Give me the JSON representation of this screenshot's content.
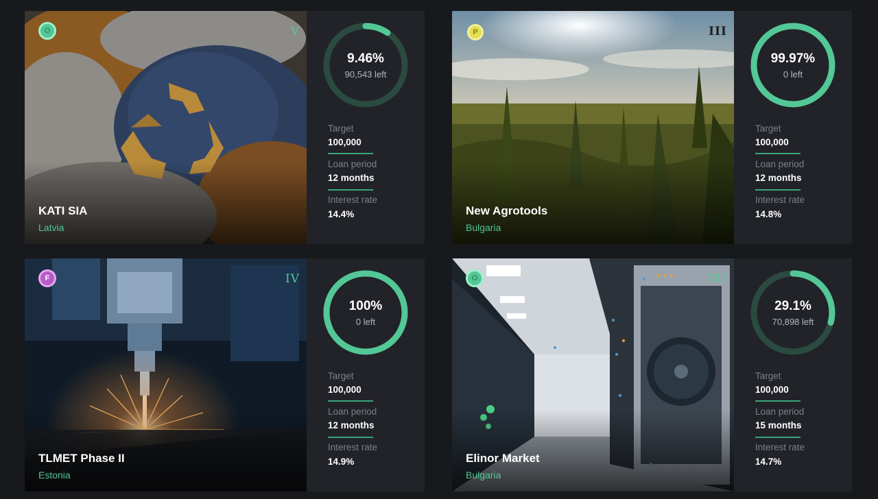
{
  "colors": {
    "background": "#17191d",
    "card": "#212328",
    "accent": "#54c796",
    "ring_track": "#2b4a40",
    "muted_text": "#7b8089"
  },
  "labels": {
    "target": "Target",
    "loan_period": "Loan period",
    "interest_rate": "Interest rate"
  },
  "cards": [
    {
      "name": "KATI SIA",
      "country": "Latvia",
      "badge_letter": "O",
      "roman": "V",
      "progress_label": "9.46%",
      "progress_fraction": 0.0946,
      "left_text": "90,543 left",
      "target": "100,000",
      "loan_period": "12 months",
      "interest_rate": "14.4%",
      "image": "recycled-knitwear-photo"
    },
    {
      "name": "New Agrotools",
      "country": "Bulgaria",
      "badge_letter": "P",
      "roman": "III",
      "progress_label": "99.97%",
      "progress_fraction": 0.9997,
      "left_text": "0 left",
      "target": "100,000",
      "loan_period": "12 months",
      "interest_rate": "14.8%",
      "image": "hemp-field-photo"
    },
    {
      "name": "TLMET Phase II",
      "country": "Estonia",
      "badge_letter": "F",
      "roman": "IV",
      "progress_label": "100%",
      "progress_fraction": 1.0,
      "left_text": "0 left",
      "target": "100,000",
      "loan_period": "12 months",
      "interest_rate": "14.9%",
      "image": "cnc-machining-sparks-photo"
    },
    {
      "name": "Elinor Market",
      "country": "Bulgaria",
      "badge_letter": "O",
      "roman": "VII",
      "progress_label": "29.1%",
      "progress_fraction": 0.291,
      "left_text": "70,898 left",
      "target": "100,000",
      "loan_period": "15 months",
      "interest_rate": "14.7%",
      "image": "server-room-photo"
    }
  ]
}
